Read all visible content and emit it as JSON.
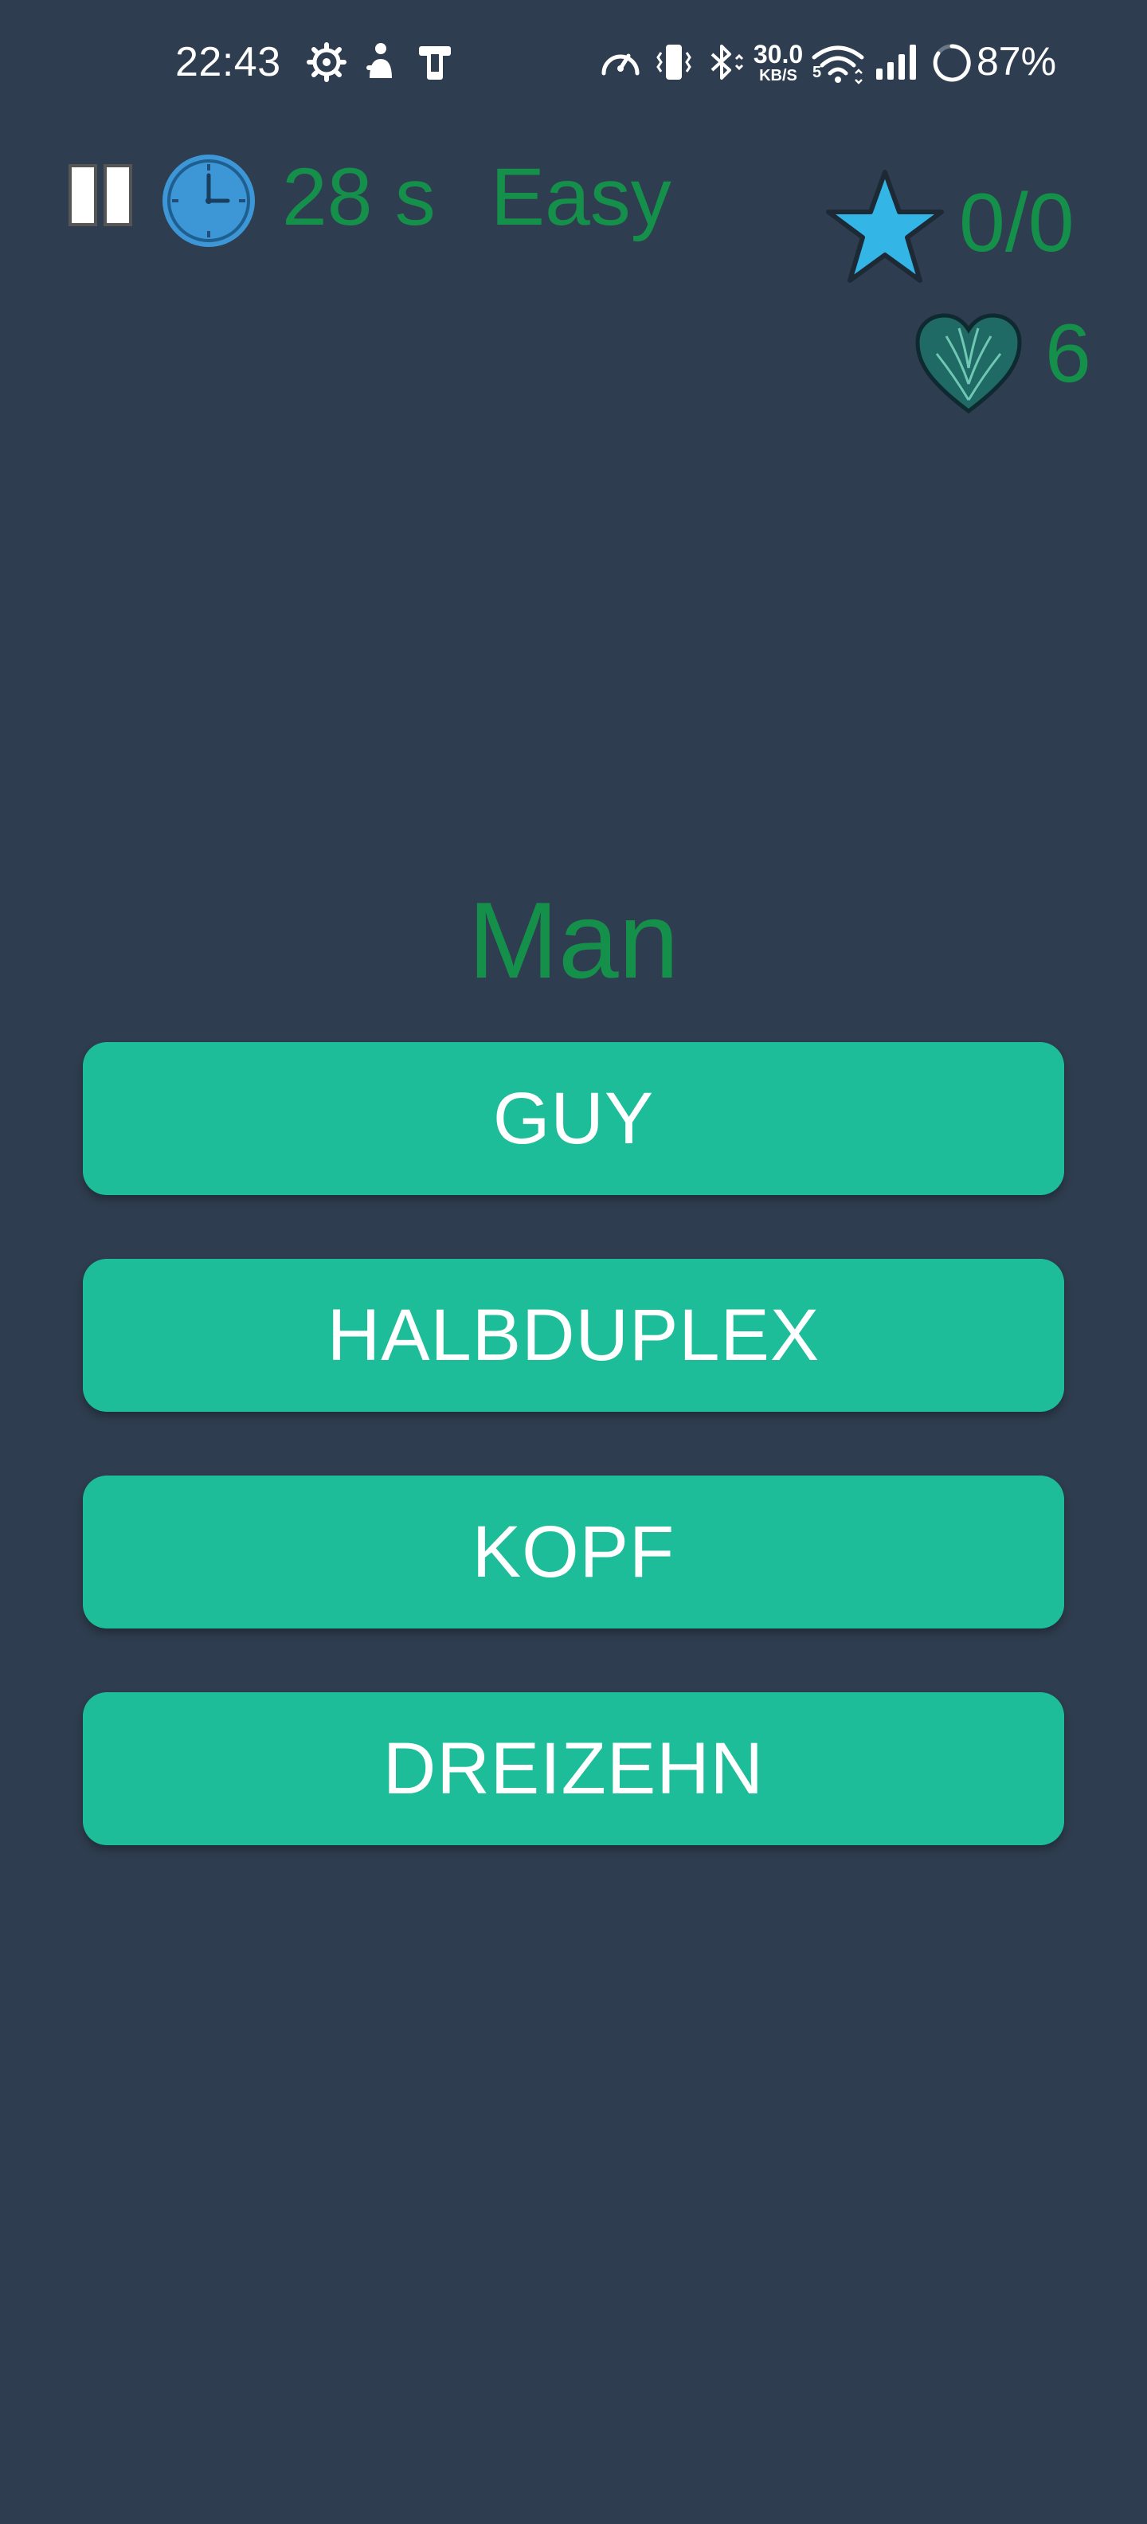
{
  "status_bar": {
    "time": "22:43",
    "network_speed_value": "30.0",
    "network_speed_unit": "KB/S",
    "signal_sub": "5",
    "battery_percent": "87%",
    "icons": [
      "settings-gear-icon",
      "accessibility-icon",
      "phone-device-icon",
      "speedometer-icon",
      "vibrate-icon",
      "bluetooth-icon",
      "wifi-icon",
      "signal-icon",
      "battery-ring-icon"
    ]
  },
  "game": {
    "timer": "28 s",
    "level": "Easy",
    "score": "0/0",
    "lives": "6",
    "icons": [
      "pause-icon",
      "clock-icon",
      "star-icon",
      "heart-icon"
    ]
  },
  "question": {
    "word": "Man"
  },
  "answers": [
    {
      "label": "GUY"
    },
    {
      "label": "HALBDUPLEX"
    },
    {
      "label": "KOPF"
    },
    {
      "label": "DREIZEHN"
    }
  ],
  "colors": {
    "background": "#2e3d4f",
    "accent_text": "#15904a",
    "button": "#1ebd9a",
    "button_text": "#ffffff",
    "star": "#33b5e5"
  }
}
